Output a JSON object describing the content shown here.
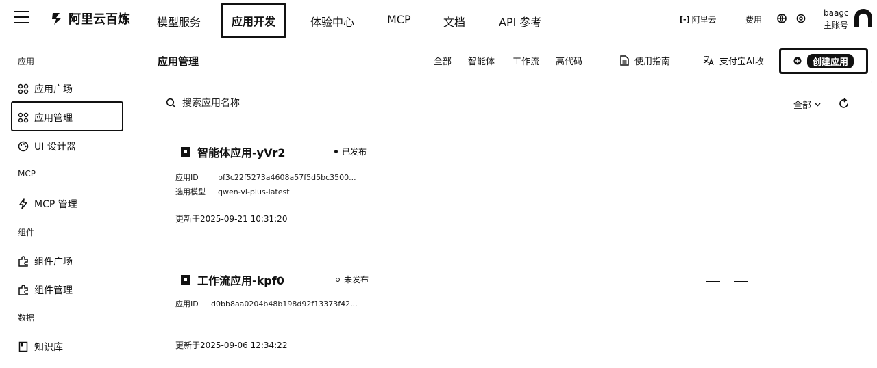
{
  "header": {
    "brand": "阿里云百炼",
    "nav": [
      "模型服务",
      "应用开发",
      "体验中心",
      "MCP",
      "文档",
      "API 参考"
    ],
    "active_nav": "应用开发",
    "aliyun": "阿里云",
    "fee": "费用",
    "user_name": "baagc",
    "user_role": "主账号"
  },
  "sidebar": {
    "groups": [
      {
        "label": "应用",
        "items": [
          {
            "label": "应用广场",
            "icon": "grid-icon"
          },
          {
            "label": "应用管理",
            "icon": "grid-icon"
          },
          {
            "label": "UI 设计器",
            "icon": "palette-icon"
          }
        ]
      },
      {
        "label": "MCP",
        "items": [
          {
            "label": "MCP 管理",
            "icon": "lightning-icon"
          }
        ]
      },
      {
        "label": "组件",
        "items": [
          {
            "label": "组件广场",
            "icon": "puzzle-icon"
          },
          {
            "label": "组件管理",
            "icon": "puzzle-icon"
          }
        ]
      },
      {
        "label": "数据",
        "items": [
          {
            "label": "知识库",
            "icon": "book-icon"
          }
        ]
      }
    ],
    "active": "应用管理"
  },
  "main": {
    "title": "应用管理",
    "filters": [
      "全部",
      "智能体",
      "工作流",
      "高代码"
    ],
    "guide": "使用指南",
    "alipay": "支付宝AI收",
    "create": "创建应用",
    "search_placeholder": "搜索应用名称",
    "sort": "全部",
    "apps": [
      {
        "name": "智能体应用-yVr2",
        "status": "已发布",
        "id_label": "应用ID",
        "id": "bf3c22f5273a4608a57f5d5bc3500...",
        "model_label": "选用模型",
        "model": "qwen-vl-plus-latest",
        "updated": "更新于2025-09-21 10:31:20"
      },
      {
        "name": "工作流应用-kpf0",
        "status": "未发布",
        "id_label": "应用ID",
        "id": "d0bb8aa0204b48b198d92f13373f42...",
        "updated": "更新于2025-09-06 12:34:22"
      }
    ]
  }
}
